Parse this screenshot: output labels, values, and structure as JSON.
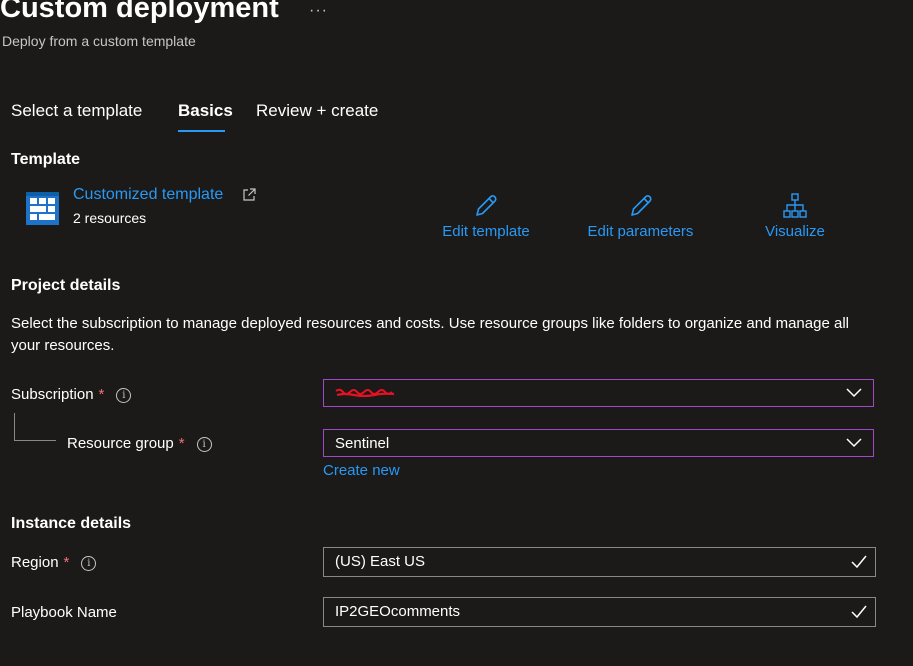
{
  "header": {
    "title": "Custom deployment",
    "more": "···",
    "subtitle": "Deploy from a custom template"
  },
  "tabs": [
    {
      "label": "Select a template",
      "active": false
    },
    {
      "label": "Basics",
      "active": true
    },
    {
      "label": "Review + create",
      "active": false
    }
  ],
  "template": {
    "heading": "Template",
    "link_label": "Customized template",
    "resources": "2 resources",
    "actions": {
      "edit_template": "Edit template",
      "edit_parameters": "Edit parameters",
      "visualize": "Visualize"
    }
  },
  "project": {
    "heading": "Project details",
    "description": "Select the subscription to manage deployed resources and costs. Use resource groups like folders to organize and manage all your resources.",
    "subscription_label": "Subscription",
    "subscription_value": "",
    "resource_group_label": "Resource group",
    "resource_group_value": "Sentinel",
    "create_new": "Create new",
    "required_marker": "*",
    "info_glyph": "i"
  },
  "instance": {
    "heading": "Instance details",
    "region_label": "Region",
    "region_value": "(US) East US",
    "playbook_label": "Playbook Name",
    "playbook_value": "IP2GEOcomments"
  },
  "colors": {
    "background": "#1b1a19",
    "link": "#2899f5",
    "required": "#f1707b",
    "select_border": "#a048c9",
    "redaction": "#e81123"
  },
  "icons": [
    "template-grid-icon",
    "external-link-icon",
    "pencil-icon",
    "hierarchy-icon",
    "chevron-down-icon",
    "checkmark-icon",
    "info-icon"
  ]
}
